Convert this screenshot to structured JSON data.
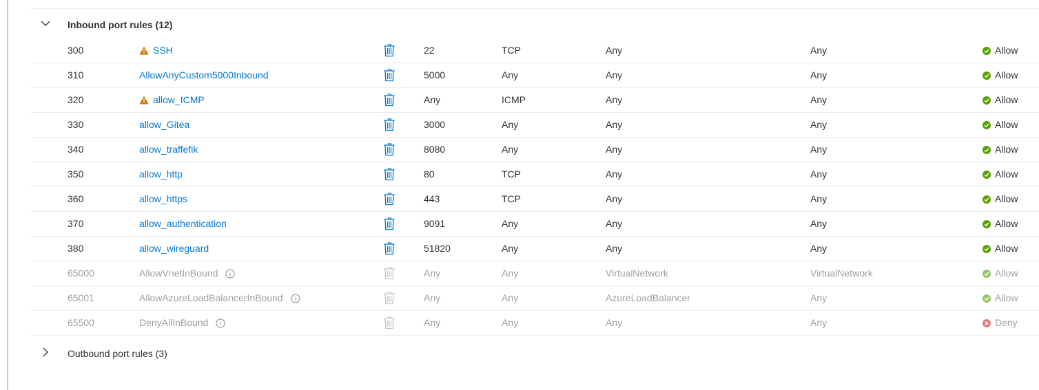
{
  "inbound": {
    "title": "Inbound port rules (12)",
    "rules": [
      {
        "priority": "300",
        "name": "SSH",
        "warning": true,
        "port": "22",
        "protocol": "TCP",
        "source": "Any",
        "destination": "Any",
        "action": "Allow",
        "default": false
      },
      {
        "priority": "310",
        "name": "AllowAnyCustom5000Inbound",
        "warning": false,
        "port": "5000",
        "protocol": "Any",
        "source": "Any",
        "destination": "Any",
        "action": "Allow",
        "default": false
      },
      {
        "priority": "320",
        "name": "allow_ICMP",
        "warning": true,
        "port": "Any",
        "protocol": "ICMP",
        "source": "Any",
        "destination": "Any",
        "action": "Allow",
        "default": false
      },
      {
        "priority": "330",
        "name": "allow_Gitea",
        "warning": false,
        "port": "3000",
        "protocol": "Any",
        "source": "Any",
        "destination": "Any",
        "action": "Allow",
        "default": false
      },
      {
        "priority": "340",
        "name": "allow_traffefik",
        "warning": false,
        "port": "8080",
        "protocol": "Any",
        "source": "Any",
        "destination": "Any",
        "action": "Allow",
        "default": false
      },
      {
        "priority": "350",
        "name": "allow_http",
        "warning": false,
        "port": "80",
        "protocol": "TCP",
        "source": "Any",
        "destination": "Any",
        "action": "Allow",
        "default": false
      },
      {
        "priority": "360",
        "name": "allow_https",
        "warning": false,
        "port": "443",
        "protocol": "TCP",
        "source": "Any",
        "destination": "Any",
        "action": "Allow",
        "default": false
      },
      {
        "priority": "370",
        "name": "allow_authentication",
        "warning": false,
        "port": "9091",
        "protocol": "Any",
        "source": "Any",
        "destination": "Any",
        "action": "Allow",
        "default": false
      },
      {
        "priority": "380",
        "name": "allow_wireguard",
        "warning": false,
        "port": "51820",
        "protocol": "Any",
        "source": "Any",
        "destination": "Any",
        "action": "Allow",
        "default": false
      },
      {
        "priority": "65000",
        "name": "AllowVnetInBound",
        "warning": false,
        "port": "Any",
        "protocol": "Any",
        "source": "VirtualNetwork",
        "destination": "VirtualNetwork",
        "action": "Allow",
        "default": true
      },
      {
        "priority": "65001",
        "name": "AllowAzureLoadBalancerInBound",
        "warning": false,
        "port": "Any",
        "protocol": "Any",
        "source": "AzureLoadBalancer",
        "destination": "Any",
        "action": "Allow",
        "default": true
      },
      {
        "priority": "65500",
        "name": "DenyAllInBound",
        "warning": false,
        "port": "Any",
        "protocol": "Any",
        "source": "Any",
        "destination": "Any",
        "action": "Deny",
        "default": true
      }
    ]
  },
  "outbound": {
    "title": "Outbound port rules (3)"
  },
  "colors": {
    "link": "#0078d4",
    "allow": "#57a300",
    "allow_disabled": "#95c76a",
    "deny": "#e07a7d",
    "warning": "#d47500",
    "muted": "#a19f9d",
    "divider": "#edebe9"
  },
  "icons": {
    "expanded": "chevron-down-icon",
    "collapsed": "chevron-right-icon",
    "delete": "trash-icon",
    "warning": "warning-icon",
    "info": "info-icon",
    "allow": "check-circle-icon",
    "deny": "x-circle-icon"
  }
}
